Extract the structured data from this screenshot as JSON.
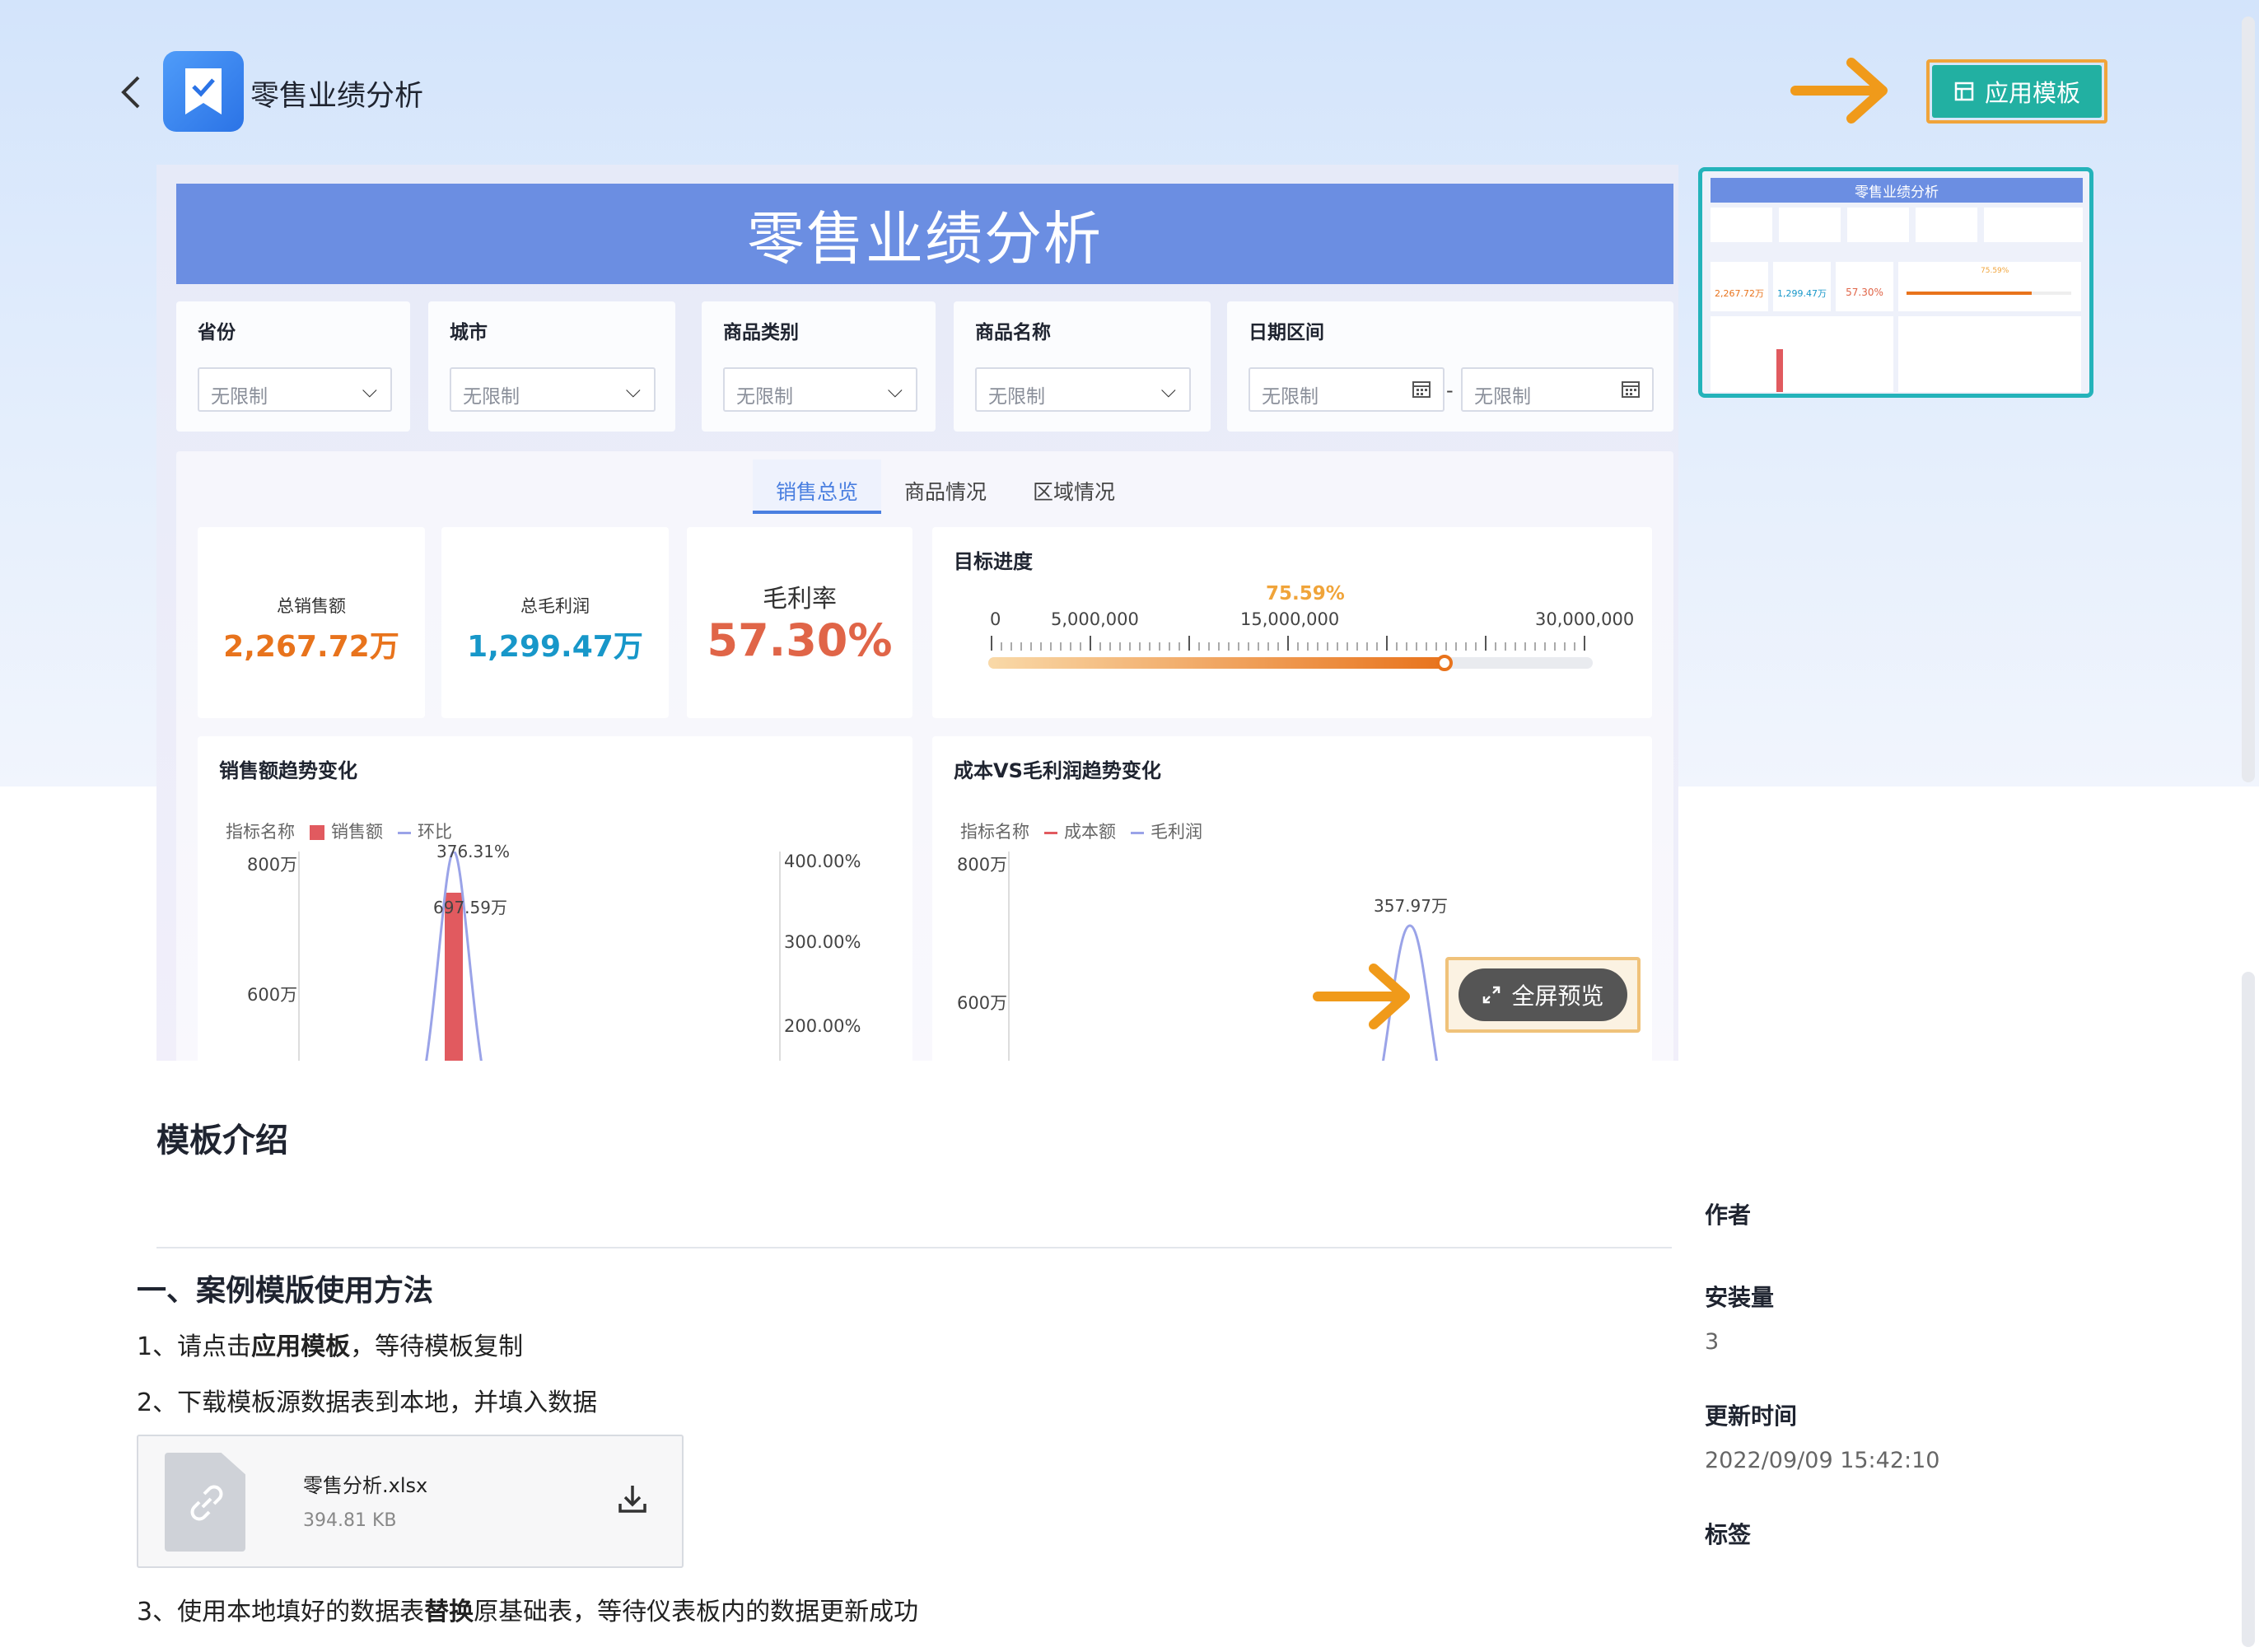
{
  "header": {
    "title": "零售业绩分析",
    "apply_label": "应用模板"
  },
  "dashboard": {
    "title": "零售业绩分析",
    "filters": [
      {
        "label": "省份",
        "value": "无限制"
      },
      {
        "label": "城市",
        "value": "无限制"
      },
      {
        "label": "商品类别",
        "value": "无限制"
      },
      {
        "label": "商品名称",
        "value": "无限制"
      },
      {
        "label": "日期区间",
        "start": "无限制",
        "end": "无限制"
      }
    ],
    "date_separator": "-",
    "tabs": [
      "销售总览",
      "商品情况",
      "区域情况"
    ],
    "kpis": {
      "sales_label": "总销售额",
      "sales_value": "2,267.72万",
      "profit_label": "总毛利润",
      "profit_value": "1,299.47万",
      "margin_label": "毛利率",
      "margin_value": "57.30%"
    },
    "target": {
      "title": "目标进度",
      "percent_label": "75.59%",
      "progress": 0.7559,
      "ticks": [
        "0",
        "5,000,000",
        "15,000,000",
        "30,000,000"
      ]
    },
    "sales_trend": {
      "title": "销售额趋势变化",
      "legend_title": "指标名称",
      "legend": [
        "销售额",
        "环比"
      ],
      "y_left": [
        "800万",
        "600万"
      ],
      "y_right": [
        "400.00%",
        "300.00%",
        "200.00%"
      ],
      "label_ratio": "376.31%",
      "label_value": "697.59万"
    },
    "cost_trend": {
      "title": "成本VS毛利润趋势变化",
      "legend_title": "指标名称",
      "legend": [
        "成本额",
        "毛利润"
      ],
      "y_left": [
        "800万",
        "600万"
      ],
      "label_value": "357.97万"
    },
    "fullscreen_label": "全屏预览"
  },
  "thumbnail": {
    "title": "零售业绩分析",
    "kpis": [
      "2,267.72万",
      "1,299.47万",
      "57.30%"
    ],
    "progress": "75.59%"
  },
  "intro": {
    "title": "模板介绍",
    "section": "一、案例模版使用方法",
    "step1_pre": "1、请点击",
    "step1_bold": "应用模板",
    "step1_post": "，等待模板复制",
    "step2": "2、下载模板源数据表到本地，并填入数据",
    "step3_pre": "3、使用本地填好的数据表",
    "step3_bold": "替换",
    "step3_post": "原基础表，等待仪表板内的数据更新成功",
    "file_name": "零售分析.xlsx",
    "file_size": "394.81 KB"
  },
  "sidebar": {
    "author_label": "作者",
    "installs_label": "安装量",
    "installs_value": "3",
    "updated_label": "更新时间",
    "updated_value": "2022/09/09 15:42:10",
    "tags_label": "标签"
  },
  "colors": {
    "accent": "#22b0a2",
    "banner": "#6b8ee2",
    "highlight": "#f0a43a",
    "sales": "#e8731c",
    "profit": "#1797c9",
    "margin": "#e06548"
  }
}
